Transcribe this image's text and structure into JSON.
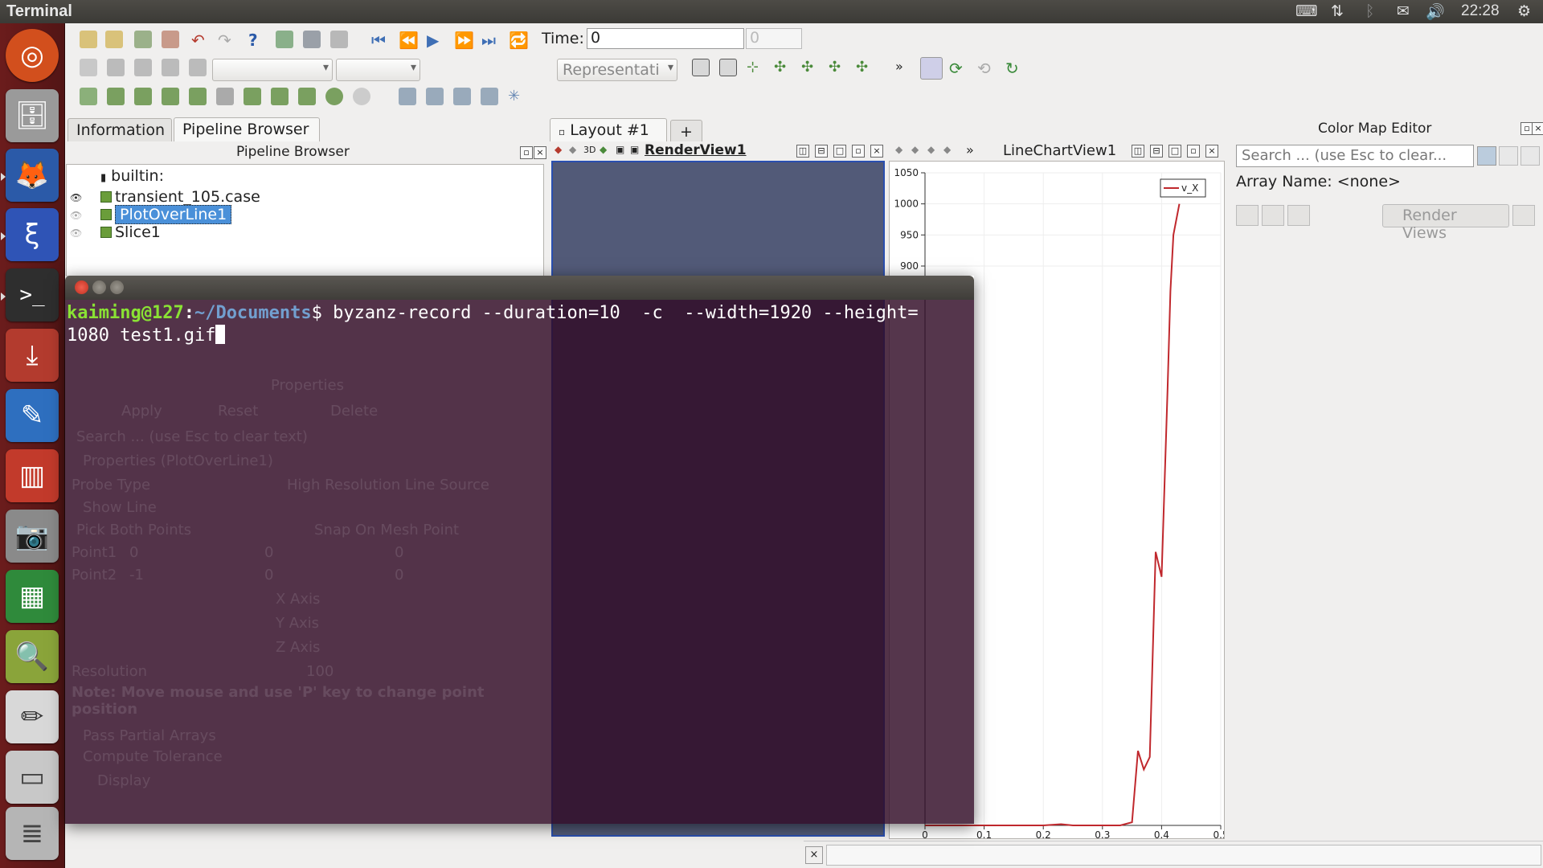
{
  "topbar": {
    "app_title": "Terminal",
    "clock": "22:28"
  },
  "launcher": {
    "items": [
      "ubuntu-dash-icon",
      "files-icon",
      "firefox-icon",
      "paraview-icon",
      "terminal-icon",
      "installer-icon",
      "libreoffice-writer-icon",
      "impress-icon",
      "camera-icon",
      "calc-icon",
      "search-icon",
      "text-editor-icon",
      "drive-icon",
      "drive-stack-icon"
    ]
  },
  "toolbar": {
    "time_label": "Time:",
    "time_value": "0",
    "timestep_value": "0",
    "representation_placeholder": "Representati"
  },
  "left_panel": {
    "tabs": [
      "Information",
      "Pipeline Browser"
    ],
    "title": "Pipeline Browser",
    "tree": [
      "builtin:",
      "transient_105.case",
      "PlotOverLine1",
      "Slice1"
    ]
  },
  "layout": {
    "tab_label": "Layout #1",
    "add_tab": "+"
  },
  "render_view": {
    "title": "RenderView1",
    "btn_3d": "3D"
  },
  "line_chart": {
    "title": "LineChartView1"
  },
  "color_map_editor": {
    "title": "Color Map Editor",
    "search_placeholder": "Search ... (use Esc to clear...",
    "array_name": "Array Name: <none>",
    "render_views_button": "Render Views"
  },
  "terminal": {
    "prompt_user": "kaiming@127",
    "prompt_sep": ":",
    "prompt_path": "~/Documents",
    "prompt_dollar": "$",
    "command_line1": " byzanz-record --duration=10  -c  --width=1920 --height=",
    "command_line2": "1080 test1.gif"
  },
  "properties_ghost": {
    "title": "Properties",
    "apply": "Apply",
    "reset": "Reset",
    "delete": "Delete",
    "search": "Search ... (use Esc to clear text)",
    "section": "Properties (PlotOverLine1)",
    "probe_type_label": "Probe Type",
    "probe_type_value": "High Resolution Line Source",
    "show_line": "Show Line",
    "pick_both": "Pick Both Points",
    "snap": "Snap On Mesh Point",
    "point1_label": "Point1",
    "point1_values": [
      "0",
      "0",
      "0"
    ],
    "point2_label": "Point2",
    "point2_values": [
      "-1",
      "0",
      "0"
    ],
    "x_axis": "X Axis",
    "y_axis": "Y Axis",
    "z_axis": "Z Axis",
    "resolution_label": "Resolution",
    "resolution_value": "100",
    "note": "Note: Move mouse and use 'P' key to change point position",
    "pass_partial": "Pass Partial Arrays",
    "compute_tolerance": "Compute Tolerance",
    "display": "Display"
  },
  "chart_data": {
    "type": "line",
    "series": [
      {
        "name": "v_X",
        "x": [
          0.0,
          0.05,
          0.1,
          0.15,
          0.2,
          0.23,
          0.25,
          0.28,
          0.3,
          0.33,
          0.35,
          0.36,
          0.37,
          0.38,
          0.39,
          0.4,
          0.405,
          0.41,
          0.415,
          0.42,
          0.43
        ],
        "y": [
          0,
          0,
          0,
          0,
          0,
          2,
          0,
          0,
          0,
          0,
          5,
          120,
          90,
          110,
          440,
          400,
          550,
          700,
          860,
          950,
          1000
        ]
      }
    ],
    "x_ticks": [
      "0",
      "0.1",
      "0.2",
      "0.3",
      "0.4",
      "0.5"
    ],
    "y_ticks": [
      "1050",
      "1000",
      "950",
      "900"
    ],
    "xlim": [
      0,
      0.5
    ],
    "ylim": [
      0,
      1050
    ],
    "legend": "top-right",
    "color": "#c0282d"
  }
}
